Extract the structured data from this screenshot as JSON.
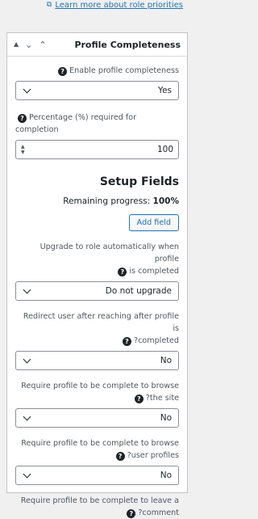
{
  "top_link": {
    "text": "Learn more about role priorities",
    "icon": "external-link-icon"
  },
  "panel": {
    "title": "Profile Completeness",
    "enable": {
      "label": "Enable profile completeness",
      "value": "Yes"
    },
    "percentage": {
      "label": "Percentage (%) required for completion",
      "value": "100"
    },
    "setup_title": "Setup Fields",
    "remaining_label": "Remaining progress:",
    "remaining_value": "100%",
    "add_field": "Add field",
    "upgrade": {
      "label_line1": "Upgrade to role automatically when profile",
      "label_line2": "is completed",
      "value": "Do not upgrade"
    },
    "redirect": {
      "label_line1": "Redirect user after reaching after profile is",
      "label_line2": "?completed",
      "value": "No"
    },
    "browse_site": {
      "label_line1": "Require profile to be complete to browse",
      "label_line2": "?the site",
      "value": "No"
    },
    "browse_profiles": {
      "label_line1": "Require profile to be complete to browse",
      "label_line2": "?user profiles",
      "value": "No"
    },
    "leave_comment": {
      "label_line1": "Require profile to be complete to leave a",
      "label_line2": "?comment"
    }
  },
  "colors": {
    "accent": "#2271b1",
    "border": "#8c8f94"
  }
}
